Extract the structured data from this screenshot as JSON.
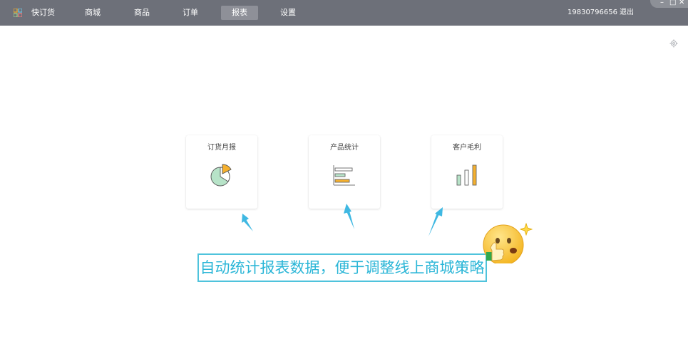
{
  "header": {
    "brand": "快订货",
    "nav": [
      "商城",
      "商品",
      "订单",
      "报表",
      "设置"
    ],
    "active_nav": "报表",
    "phone": "19830796656",
    "logout": "退出"
  },
  "cards": [
    {
      "title": "订货月报",
      "icon": "pie-chart-icon"
    },
    {
      "title": "产品统计",
      "icon": "horizontal-bar-chart-icon"
    },
    {
      "title": "客户毛利",
      "icon": "vertical-bar-chart-icon"
    }
  ],
  "caption": "自动统计报表数据，便于调整线上商城策略",
  "colors": {
    "topbar": "#6d7079",
    "active_tab": "#8e9098",
    "accent_orange": "#f5b02e",
    "accent_green": "#b7e3c8",
    "caption_blue": "#2bb6d7",
    "arrow_blue": "#3fb8e2"
  },
  "icons": [
    "app-grid-icon",
    "gear-icon",
    "thumbs-up-emoji-icon",
    "sparkle-icon",
    "minimize-icon",
    "maximize-icon",
    "close-icon"
  ]
}
